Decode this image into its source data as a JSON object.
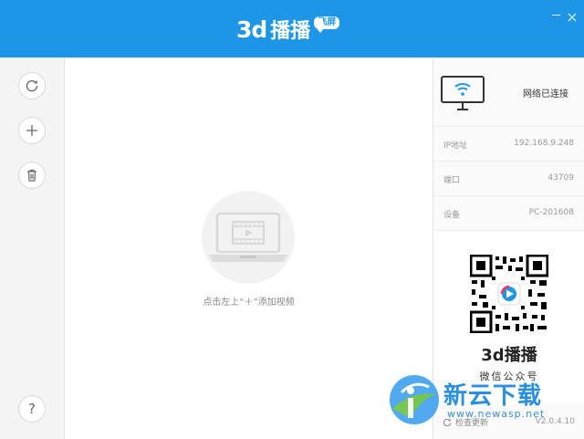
{
  "app": {
    "logo_text": "3d",
    "logo_cn": "播播",
    "logo_badge": "飞屏"
  },
  "toolbar": {
    "refresh": "refresh-icon",
    "add": "plus-icon",
    "delete": "trash-icon",
    "help_label": "?"
  },
  "main": {
    "empty_hint": "点击左上“＋”添加视频"
  },
  "device": {
    "status": "网络已连接",
    "rows": [
      {
        "label": "IP地址",
        "value": "192.168.9.248"
      },
      {
        "label": "端口",
        "value": "43709"
      },
      {
        "label": "设备",
        "value": "PC-201608"
      }
    ]
  },
  "promo": {
    "brand": "3d播播",
    "subtitle": "微信公众号"
  },
  "footer": {
    "update_label": "检查更新",
    "version": "V2.0.4.10"
  },
  "watermark": {
    "name": "新云下载",
    "url": "www.newasp.net"
  },
  "colors": {
    "accent": "#1e96e8"
  }
}
